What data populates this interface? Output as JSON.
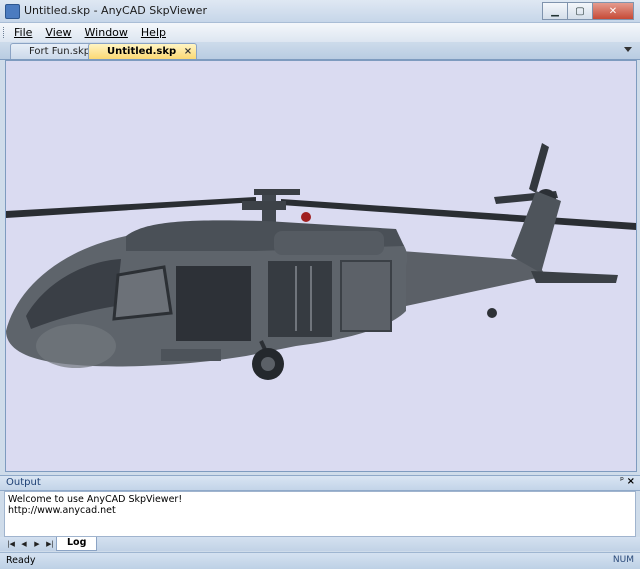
{
  "window": {
    "title": "Untitled.skp - AnyCAD SkpViewer",
    "icons": {
      "app": "app-icon",
      "minimize": "minimize-icon",
      "maximize": "maximize-icon",
      "close": "close-icon"
    },
    "buttons": {
      "minimize": "▁",
      "maximize": "▢",
      "close": "✕"
    }
  },
  "menu": {
    "items": [
      {
        "label": "File"
      },
      {
        "label": "View"
      },
      {
        "label": "Window"
      },
      {
        "label": "Help"
      }
    ]
  },
  "tabs": [
    {
      "label": "Fort Fun.skp",
      "active": false
    },
    {
      "label": "Untitled.skp",
      "active": true,
      "close": "×"
    }
  ],
  "viewport": {
    "background": "#dadbf1",
    "content": "helicopter-3d-model"
  },
  "output": {
    "title": "Output",
    "pin": "ᵖ",
    "close": "×",
    "lines": [
      "Welcome to use AnyCAD SkpViewer!",
      "http://www.anycad.net"
    ]
  },
  "log": {
    "nav": [
      "|◀",
      "◀",
      "▶",
      "▶|"
    ],
    "tab": "Log"
  },
  "status": {
    "ready": "Ready",
    "num": "NUM"
  }
}
